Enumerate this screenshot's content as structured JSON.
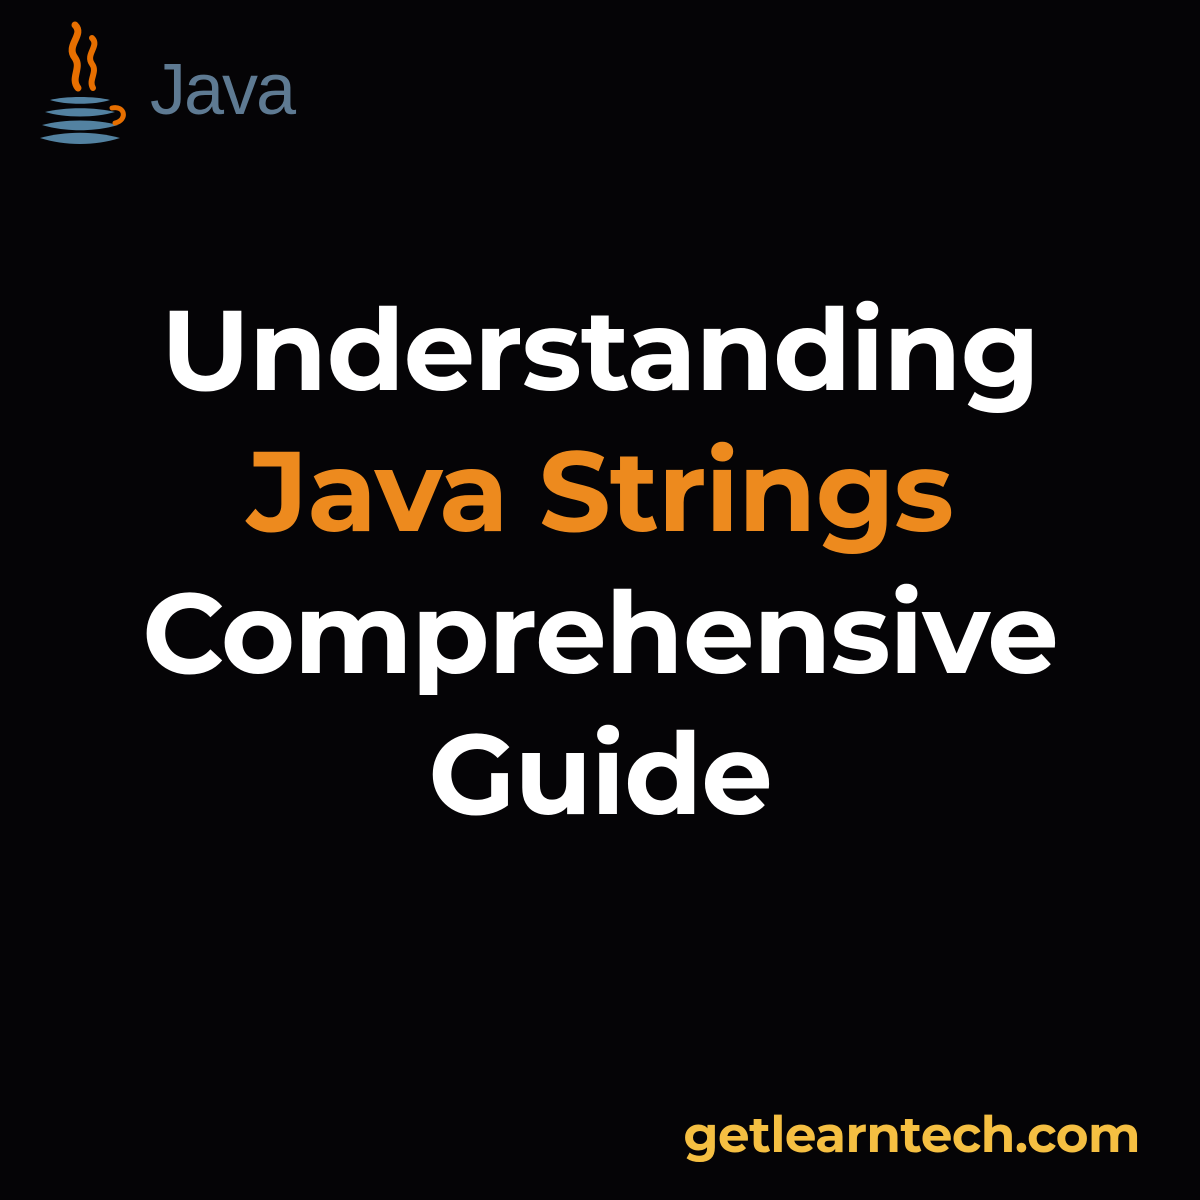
{
  "logo": {
    "text": "Java",
    "icon_name": "java-cup-icon"
  },
  "title": {
    "line1": "Understanding",
    "line2": "Java Strings",
    "line3": "Comprehensive",
    "line4": "Guide"
  },
  "footer": {
    "url": "getlearntech.com"
  },
  "colors": {
    "background": "#050406",
    "text_white": "#ffffff",
    "text_orange": "#ed8a1e",
    "text_yellow": "#f5bf42",
    "logo_text": "#5e7a92",
    "logo_steam_orange": "#e76f00",
    "logo_cup_blue": "#5382a1"
  }
}
